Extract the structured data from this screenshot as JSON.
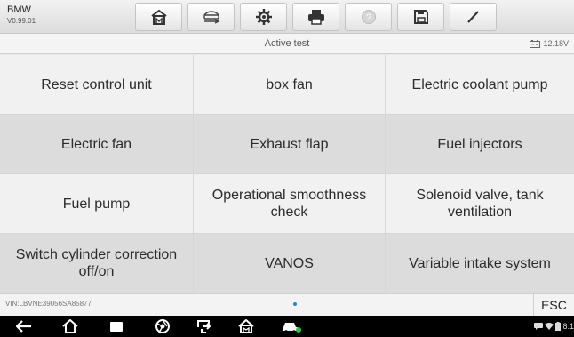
{
  "app": {
    "brand": "BMW",
    "version": "V0.99.01"
  },
  "toolbar": {
    "buttons": [
      {
        "name": "home-icon"
      },
      {
        "name": "vehicle-swap-icon"
      },
      {
        "name": "settings-icon"
      },
      {
        "name": "print-icon"
      },
      {
        "name": "help-icon"
      },
      {
        "name": "save-icon"
      },
      {
        "name": "edit-icon"
      }
    ]
  },
  "subheader": {
    "title": "Active test",
    "battery_voltage": "12.18V"
  },
  "tests": [
    "Reset control unit",
    "box fan",
    "Electric coolant pump",
    "Electric fan",
    "Exhaust flap",
    "Fuel injectors",
    "Fuel pump",
    "Operational smoothness check",
    "Solenoid valve, tank ventilation",
    "Switch cylinder correction off/on",
    "VANOS",
    "Variable intake system"
  ],
  "footer": {
    "vin": "VIN:LBVNE39056SA85877",
    "esc_label": "ESC"
  },
  "navbar": {
    "time": "8:1"
  },
  "colors": {
    "accent": "#2f7fd0",
    "row_light": "#f1f1f1",
    "row_dark": "#dcdcdc"
  }
}
